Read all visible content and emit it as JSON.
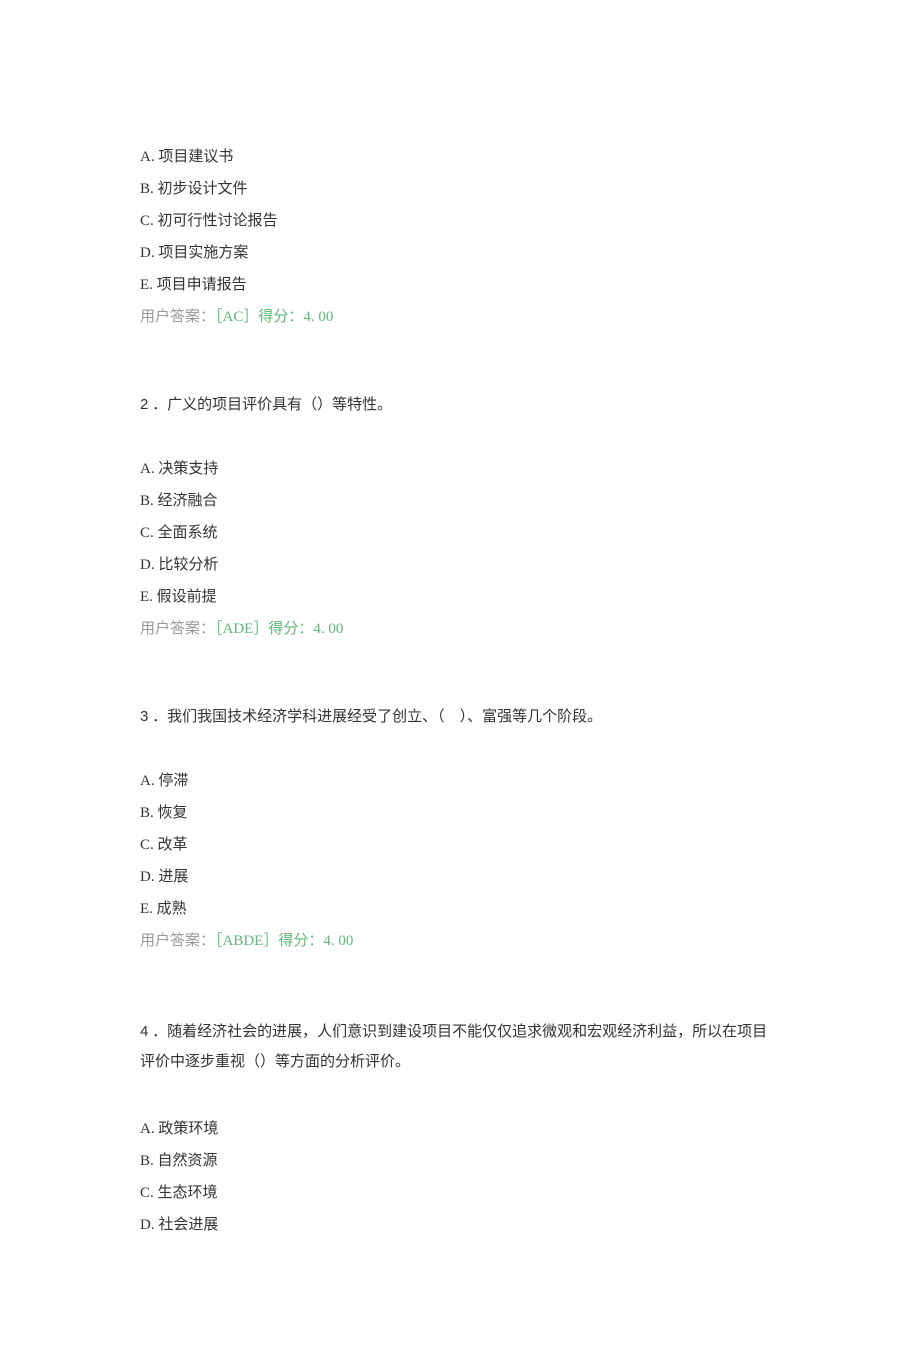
{
  "q1": {
    "options": {
      "a": "A. 项目建议书",
      "b": "B. 初步设计文件",
      "c": "C. 初可行性讨论报告",
      "d": "D. 项目实施方案",
      "e": "E. 项目申请报告"
    },
    "answerPrefix": "用户答案：",
    "answerBody": "［AC］得分：4. 00"
  },
  "q2": {
    "number": "2",
    "stem": "．广义的项目评价具有（）等特性。",
    "options": {
      "a": "A. 决策支持",
      "b": "B. 经济融合",
      "c": "C. 全面系统",
      "d": "D. 比较分析",
      "e": "E. 假设前提"
    },
    "answerPrefix": "用户答案：",
    "answerBody": "［ADE］得分：4. 00"
  },
  "q3": {
    "number": "3",
    "stem": "．我们我国技术经济学科进展经受了创立、（　）、富强等几个阶段。",
    "options": {
      "a": "A. 停滞",
      "b": "B. 恢复",
      "c": "C. 改革",
      "d": "D. 进展",
      "e": "E. 成熟"
    },
    "answerPrefix": "用户答案：",
    "answerBody": "［ABDE］得分：4. 00"
  },
  "q4": {
    "number": "4",
    "stem": "．随着经济社会的进展，人们意识到建设项目不能仅仅追求微观和宏观经济利益，所以在项目评价中逐步重视（）等方面的分析评价。",
    "options": {
      "a": "A. 政策环境",
      "b": "B. 自然资源",
      "c": "C. 生态环境",
      "d": "D. 社会进展"
    }
  }
}
